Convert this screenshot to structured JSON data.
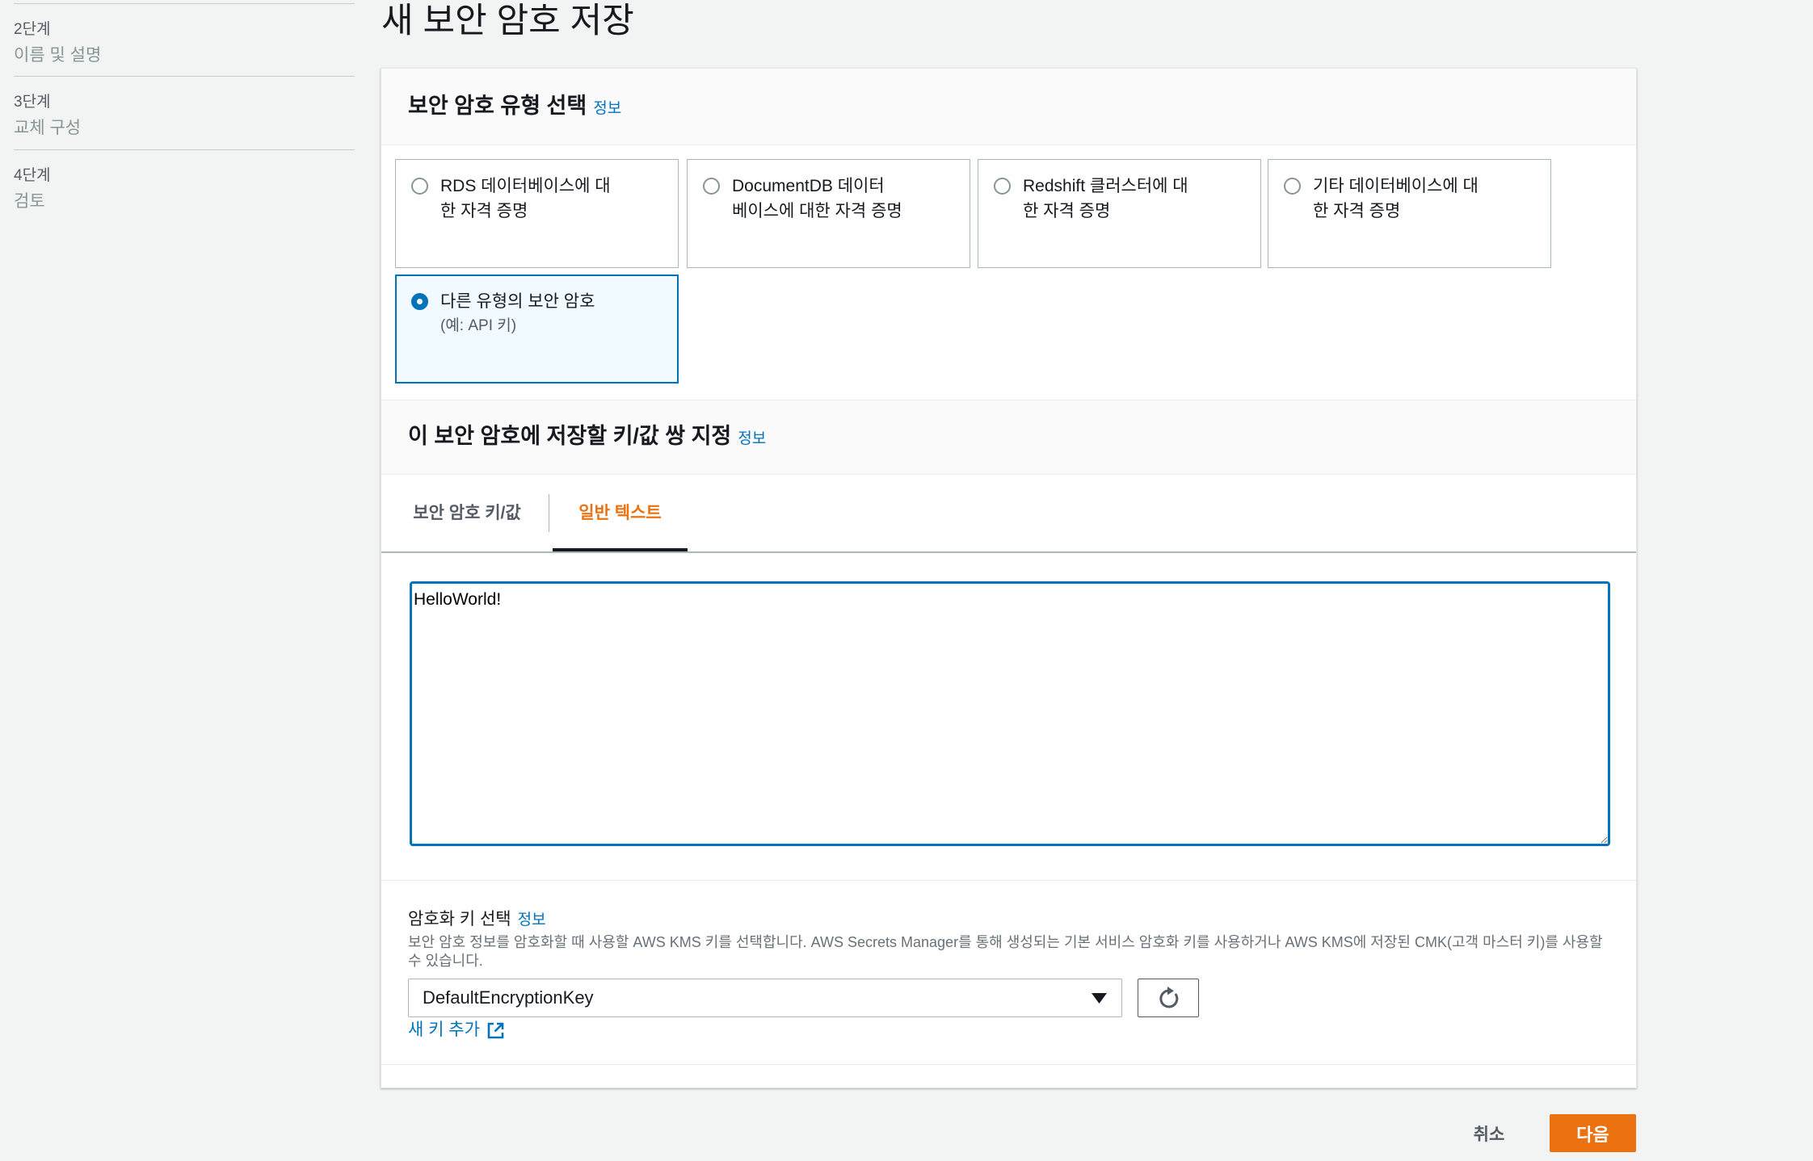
{
  "page": {
    "title": "새 보안 암호 저장"
  },
  "sidebar": {
    "steps": [
      {
        "step": "2단계",
        "name": "이름 및 설명"
      },
      {
        "step": "3단계",
        "name": "교체 구성"
      },
      {
        "step": "4단계",
        "name": "검토"
      }
    ]
  },
  "secret_type": {
    "heading": "보안 암호 유형 선택",
    "info_link": "정보",
    "selected_index": 4,
    "options": [
      {
        "label_lines": [
          "RDS 데이터베이스에 대",
          "한 자격 증명"
        ]
      },
      {
        "label_lines": [
          "DocumentDB 데이터",
          "베이스에 대한 자격 증명"
        ]
      },
      {
        "label_lines": [
          "Redshift 클러스터에 대",
          "한 자격 증명"
        ]
      },
      {
        "label_lines": [
          "기타 데이터베이스에 대",
          "한 자격 증명"
        ]
      },
      {
        "label_lines": [
          "다른 유형의 보안 암호"
        ],
        "description": "(예: API 키)"
      }
    ]
  },
  "key_value": {
    "heading": "이 보안 암호에 저장할 키/값 쌍 지정",
    "info_link": "정보",
    "active_tab_index": 1,
    "tabs": [
      {
        "label": "보안 암호 키/값"
      },
      {
        "label": "일반 텍스트"
      }
    ],
    "plaintext_value": "HelloWorld!"
  },
  "encryption": {
    "label": "암호화 키 선택",
    "info_link": "정보",
    "description": "보안 암호 정보를 암호화할 때 사용할 AWS KMS 키를 선택합니다. AWS Secrets Manager를 통해 생성되는 기본 서비스 암호화 키를 사용하거나 AWS KMS에 저장된 CMK(고객 마스터 키)를 사용할 수 있습니다.",
    "selected_key": "DefaultEncryptionKey",
    "add_key_link": "새 키 추가"
  },
  "footer": {
    "cancel_label": "취소",
    "next_label": "다음"
  },
  "icons": {
    "refresh": "refresh-icon",
    "external_link": "external-link-icon",
    "dropdown": "caret-down-icon"
  },
  "colors": {
    "accent": "#0073bb",
    "primary_button": "#ec7211",
    "active_tab": "#ec7211",
    "selected_card_background": "#f1faff",
    "page_background": "#f2f3f3"
  }
}
